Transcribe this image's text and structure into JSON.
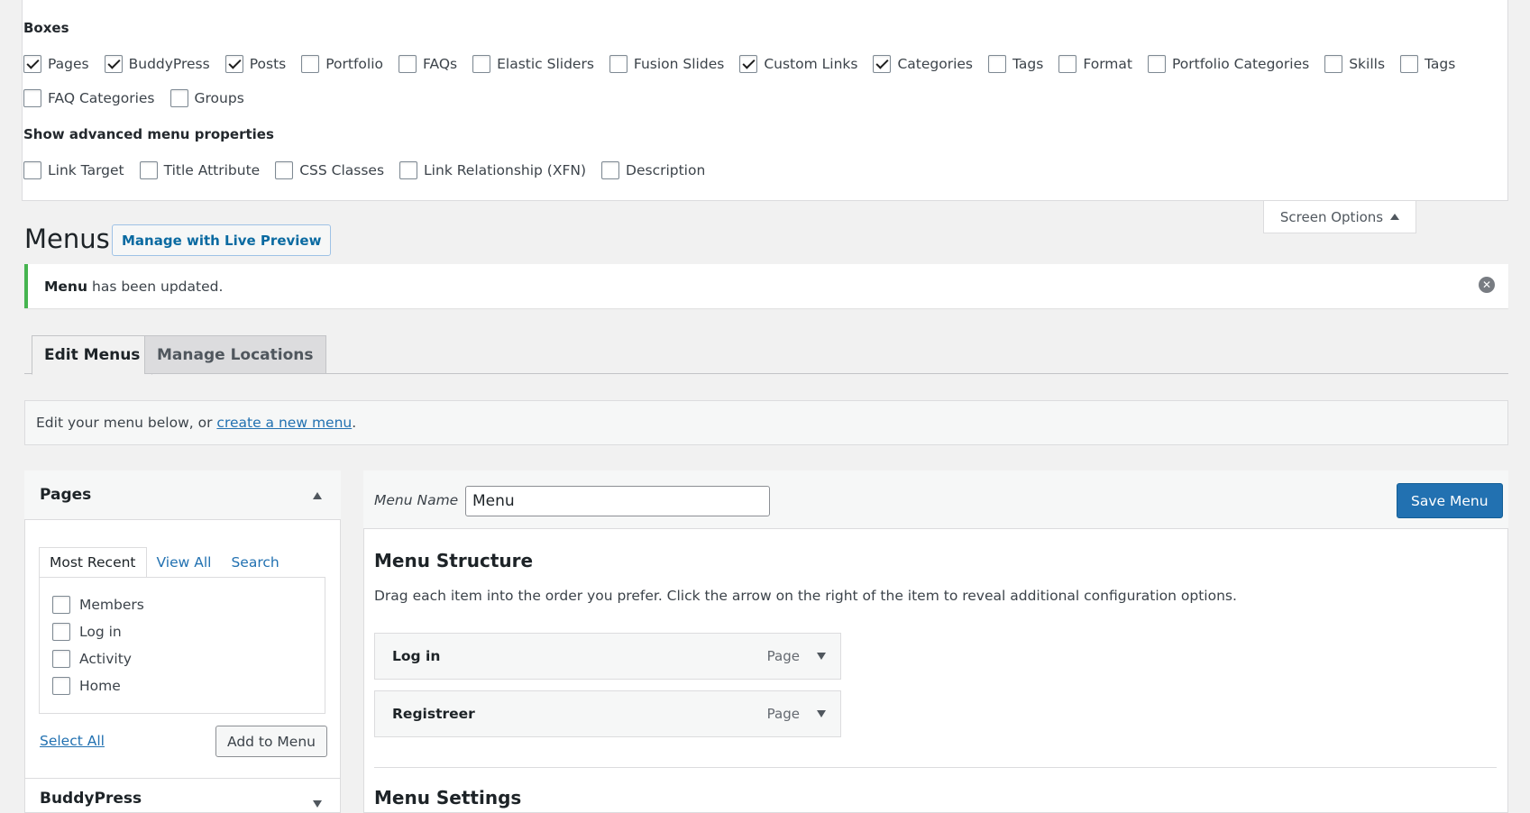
{
  "screen_options": {
    "boxes_label": "Boxes",
    "boxes": [
      {
        "label": "Pages",
        "checked": true
      },
      {
        "label": "BuddyPress",
        "checked": true
      },
      {
        "label": "Posts",
        "checked": true
      },
      {
        "label": "Portfolio",
        "checked": false
      },
      {
        "label": "FAQs",
        "checked": false
      },
      {
        "label": "Elastic Sliders",
        "checked": false
      },
      {
        "label": "Fusion Slides",
        "checked": false
      },
      {
        "label": "Custom Links",
        "checked": true
      },
      {
        "label": "Categories",
        "checked": true
      },
      {
        "label": "Tags",
        "checked": false
      },
      {
        "label": "Format",
        "checked": false
      },
      {
        "label": "Portfolio Categories",
        "checked": false
      },
      {
        "label": "Skills",
        "checked": false
      },
      {
        "label": "Tags",
        "checked": false
      },
      {
        "label": "FAQ Categories",
        "checked": false
      },
      {
        "label": "Groups",
        "checked": false
      }
    ],
    "advanced_label": "Show advanced menu properties",
    "advanced": [
      {
        "label": "Link Target",
        "checked": false
      },
      {
        "label": "Title Attribute",
        "checked": false
      },
      {
        "label": "CSS Classes",
        "checked": false
      },
      {
        "label": "Link Relationship (XFN)",
        "checked": false
      },
      {
        "label": "Description",
        "checked": false
      }
    ],
    "toggle_label": "Screen Options"
  },
  "header": {
    "title": "Menus",
    "live_preview_label": "Manage with Live Preview"
  },
  "notice": {
    "bold": "Menu",
    "text": "has been updated."
  },
  "tabs": {
    "edit": "Edit Menus",
    "manage": "Manage Locations"
  },
  "intro": {
    "text": "Edit your menu below, or ",
    "link": "create a new menu",
    "suffix": "."
  },
  "sidebar": {
    "pages_title": "Pages",
    "tabs": [
      "Most Recent",
      "View All",
      "Search"
    ],
    "items": [
      "Members",
      "Log in",
      "Activity",
      "Home"
    ],
    "select_all": "Select All",
    "add_to_menu": "Add to Menu",
    "buddypress_title": "BuddyPress"
  },
  "menu": {
    "name_label": "Menu Name",
    "name_value": "Menu",
    "save_label": "Save Menu",
    "structure_title": "Menu Structure",
    "structure_desc": "Drag each item into the order you prefer. Click the arrow on the right of the item to reveal additional configuration options.",
    "items": [
      {
        "title": "Log in",
        "type": "Page"
      },
      {
        "title": "Registreer",
        "type": "Page"
      }
    ],
    "settings_title": "Menu Settings"
  },
  "colors": {
    "primary": "#2271b1",
    "notice_success": "#46b450"
  }
}
